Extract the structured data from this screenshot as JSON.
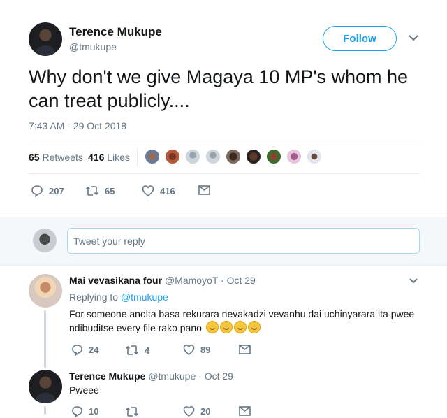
{
  "main_tweet": {
    "author_name": "Terence Mukupe",
    "author_handle": "@tmukupe",
    "follow_label": "Follow",
    "text": "Why don't we give Magaya 10 MP's whom he can treat publicly....",
    "timestamp": "7:43 AM - 29 Oct 2018",
    "retweets_count": "65",
    "retweets_label": "Retweets",
    "likes_count": "416",
    "likes_label": "Likes",
    "replies": "207",
    "retweets": "65",
    "likes": "416"
  },
  "reply_box": {
    "placeholder": "Tweet your reply"
  },
  "replies": [
    {
      "author_name": "Mai vevasikana four",
      "author_handle": "@MamoyoT",
      "date": "· Oct 29",
      "replying_to_label": "Replying to",
      "replying_to_handle": "@tmukupe",
      "text": "For someone anoita basa rekurara nevakadzi vevanhu dai uchinyarara ita pwee ndibuditse every file rako pano",
      "replies": "24",
      "retweets": "4",
      "likes": "89"
    },
    {
      "author_name": "Terence Mukupe",
      "author_handle": "@tmukupe",
      "date": "· Oct 29",
      "text": "Pweee",
      "replies": "10",
      "retweets": "",
      "likes": "20"
    }
  ],
  "colors": {
    "accent": "#1da1f2",
    "muted": "#657786",
    "divider": "#e6ecf0"
  }
}
